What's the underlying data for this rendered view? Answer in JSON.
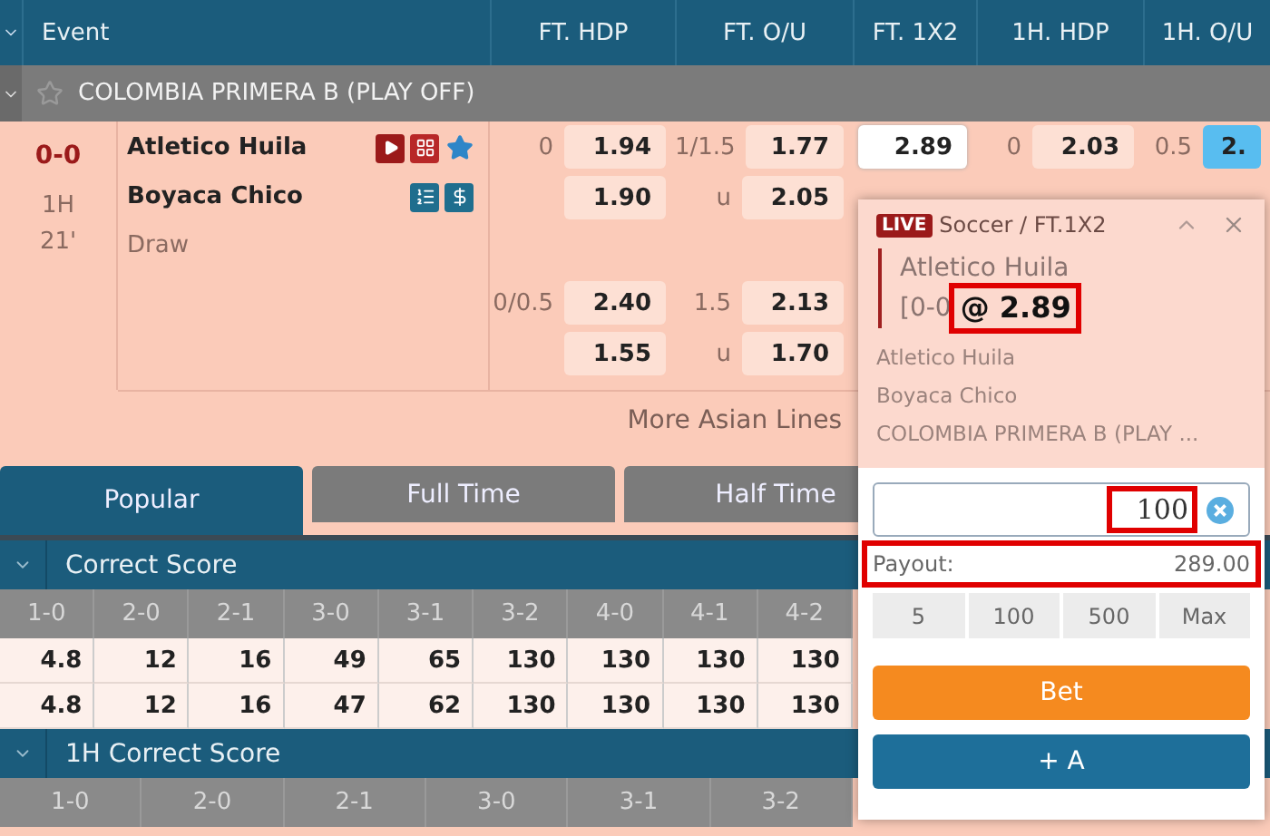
{
  "columns": [
    "Event",
    "FT. HDP",
    "FT. O/U",
    "FT. 1X2",
    "1H. HDP",
    "1H. O/U"
  ],
  "league": {
    "name": "COLOMBIA PRIMERA B (PLAY OFF)",
    "favorite": false
  },
  "match": {
    "score": "0-0",
    "period": "1H",
    "minute": "21'",
    "teams": [
      "Atletico Huila",
      "Boyaca Chico",
      "Draw"
    ],
    "favorite": true,
    "line_sets": [
      {
        "ft_hdp": [
          {
            "line": "0",
            "price": "1.94"
          },
          {
            "price": "1.90"
          }
        ],
        "ft_ou": [
          {
            "line": "1/1.5",
            "price": "1.77"
          },
          {
            "line": "u",
            "price": "2.05"
          }
        ],
        "ft_1x2": [
          {
            "price": "2.89",
            "selected": true
          }
        ],
        "h1_hdp": [
          {
            "line": "0",
            "price": "2.03",
            "selected": false
          }
        ],
        "h1_ou": [
          {
            "line": "0.5",
            "price": "2.",
            "selected": true
          }
        ]
      },
      {
        "ft_hdp": [
          {
            "line": "0/0.5",
            "price": "2.40"
          },
          {
            "price": "1.55"
          }
        ],
        "ft_ou": [
          {
            "line": "1.5",
            "price": "2.13"
          },
          {
            "line": "u",
            "price": "1.70"
          }
        ]
      }
    ],
    "more_link": "More Asian Lines"
  },
  "tabs": [
    {
      "label": "Popular",
      "selected": true
    },
    {
      "label": "Full Time",
      "selected": false
    },
    {
      "label": "Half Time",
      "selected": false
    }
  ],
  "sections": [
    {
      "title": "Correct Score",
      "expanded": true,
      "scores": [
        "1-0",
        "2-0",
        "2-1",
        "3-0",
        "3-1",
        "3-2",
        "4-0",
        "4-1",
        "4-2"
      ],
      "rows": [
        [
          "4.8",
          "12",
          "16",
          "49",
          "65",
          "130",
          "130",
          "130",
          "130"
        ],
        [
          "4.8",
          "12",
          "16",
          "47",
          "62",
          "130",
          "130",
          "130",
          "130"
        ]
      ]
    },
    {
      "title": "1H Correct Score",
      "expanded": true,
      "scores": [
        "1-0",
        "2-0",
        "2-1",
        "3-0",
        "3-1",
        "3-2"
      ]
    }
  ],
  "bet_slip": {
    "badge": "LIVE",
    "market": "Soccer / FT.1X2",
    "selection": "Atletico Huila",
    "score": "[0-0",
    "price": "@ 2.89",
    "price_highlighted": true,
    "home": "Atletico Huila",
    "away": "Boyaca Chico",
    "league": "COLOMBIA PRIMERA B (PLAY ...",
    "stake": "100",
    "stake_highlighted": true,
    "payout_label": "Payout:",
    "payout": "289.00",
    "payout_highlighted": true,
    "quick_stakes": [
      "5",
      "100",
      "500",
      "Max"
    ],
    "bet_button": "Bet",
    "add_button": "+ A"
  }
}
